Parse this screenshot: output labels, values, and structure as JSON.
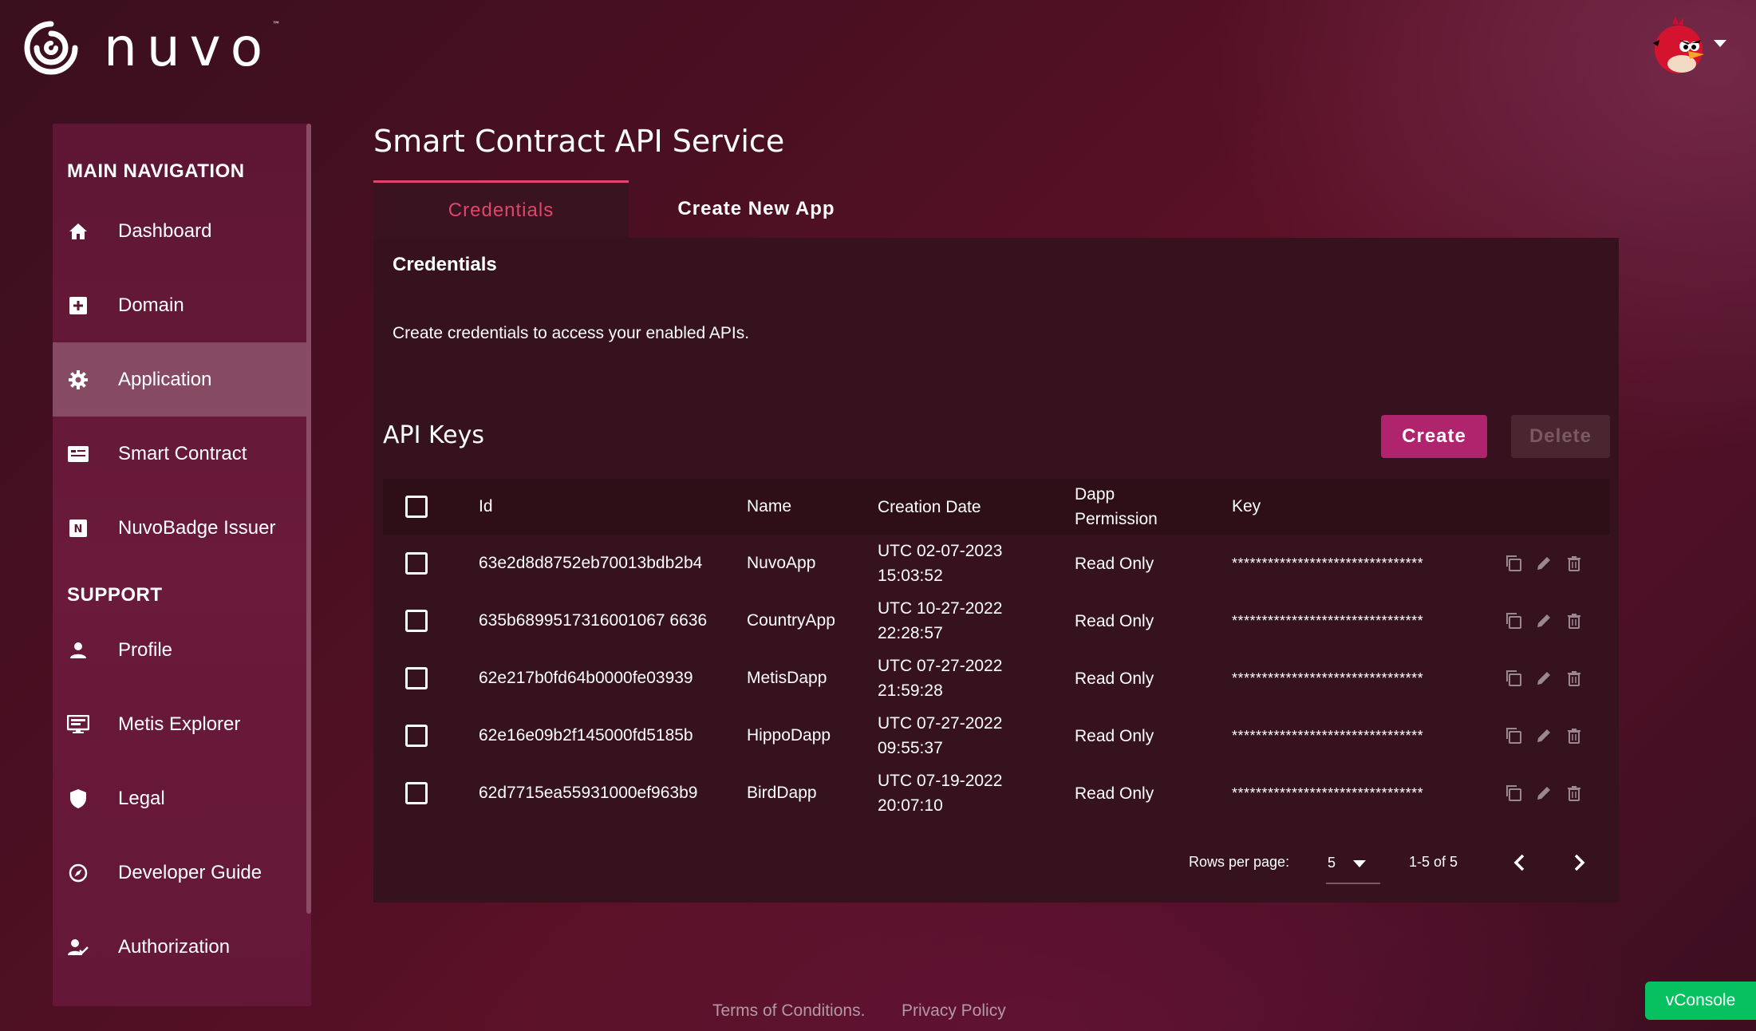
{
  "brand": {
    "name": "nuvo",
    "tm": "™"
  },
  "sidebar": {
    "main_section": "MAIN NAVIGATION",
    "support_section": "SUPPORT",
    "main_items": [
      {
        "label": "Dashboard",
        "icon": "home-icon"
      },
      {
        "label": "Domain",
        "icon": "plus-box-icon"
      },
      {
        "label": "Application",
        "icon": "gear-icon",
        "active": true
      },
      {
        "label": "Smart Contract",
        "icon": "card-icon"
      },
      {
        "label": "NuvoBadge Issuer",
        "icon": "badge-n-icon"
      }
    ],
    "support_items": [
      {
        "label": "Profile",
        "icon": "person-icon"
      },
      {
        "label": "Metis Explorer",
        "icon": "monitor-icon"
      },
      {
        "label": "Legal",
        "icon": "shield-icon"
      },
      {
        "label": "Developer Guide",
        "icon": "compass-icon"
      },
      {
        "label": "Authorization",
        "icon": "person-check-icon"
      }
    ]
  },
  "main": {
    "title": "Smart Contract API Service",
    "tabs": [
      {
        "label": "Credentials",
        "active": true
      },
      {
        "label": "Create New App",
        "active": false
      }
    ],
    "card": {
      "heading": "Credentials",
      "description": "Create credentials to access your enabled APIs.",
      "api_keys_title": "API Keys",
      "create_label": "Create",
      "delete_label": "Delete"
    },
    "table": {
      "headers": {
        "id": "Id",
        "name": "Name",
        "date": "Creation Date",
        "perm_line1": "Dapp",
        "perm_line2": "Permission",
        "key": "Key"
      },
      "rows": [
        {
          "id": "63e2d8d8752eb70013bdb2b4",
          "name": "NuvoApp",
          "date1": "UTC 02-07-2023",
          "date2": "15:03:52",
          "perm": "Read Only",
          "key": "********************************"
        },
        {
          "id": "635b6899517316001067 6636",
          "name": "CountryApp",
          "date1": "UTC 10-27-2022",
          "date2": "22:28:57",
          "perm": "Read Only",
          "key": "********************************"
        },
        {
          "id": "62e217b0fd64b0000fe03939",
          "name": "MetisDapp",
          "date1": "UTC 07-27-2022",
          "date2": "21:59:28",
          "perm": "Read Only",
          "key": "********************************"
        },
        {
          "id": "62e16e09b2f145000fd5185b",
          "name": "HippoDapp",
          "date1": "UTC 07-27-2022",
          "date2": "09:55:37",
          "perm": "Read Only",
          "key": "********************************"
        },
        {
          "id": "62d7715ea55931000ef963b9",
          "name": "BirdDapp",
          "date1": "UTC 07-19-2022",
          "date2": "20:07:10",
          "perm": "Read Only",
          "key": "********************************"
        }
      ]
    },
    "pagination": {
      "rows_per_page_label": "Rows per page:",
      "rows_per_page": "5",
      "range": "1-5 of 5"
    }
  },
  "footer": {
    "terms": "Terms of Conditions.",
    "privacy": "Privacy Policy"
  },
  "vconsole": "vConsole",
  "colors": {
    "accent": "#e0466a",
    "create_button": "#b0246e",
    "vconsole": "#07c160"
  }
}
